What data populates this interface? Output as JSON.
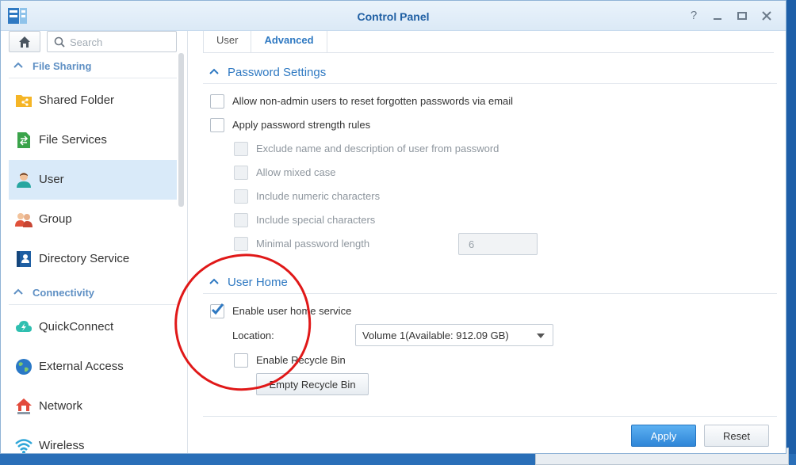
{
  "window": {
    "title": "Control Panel"
  },
  "sidebar": {
    "search_placeholder": "Search",
    "groups": [
      {
        "label": "File Sharing"
      },
      {
        "label": "Connectivity"
      }
    ],
    "items": [
      {
        "label": "Shared Folder"
      },
      {
        "label": "File Services"
      },
      {
        "label": "User"
      },
      {
        "label": "Group"
      },
      {
        "label": "Directory Service"
      },
      {
        "label": "QuickConnect"
      },
      {
        "label": "External Access"
      },
      {
        "label": "Network"
      },
      {
        "label": "Wireless"
      }
    ],
    "active_item": "User"
  },
  "tabs": [
    {
      "label": "User"
    },
    {
      "label": "Advanced"
    }
  ],
  "active_tab": "Advanced",
  "password_settings": {
    "title": "Password Settings",
    "reset_via_email": {
      "label": "Allow non-admin users to reset forgotten passwords via email",
      "checked": false
    },
    "strength_rules": {
      "label": "Apply password strength rules",
      "checked": false
    },
    "rules": [
      {
        "label": "Exclude name and description of user from password",
        "checked": false
      },
      {
        "label": "Allow mixed case",
        "checked": false
      },
      {
        "label": "Include numeric characters",
        "checked": false
      },
      {
        "label": "Include special characters",
        "checked": false
      },
      {
        "label": "Minimal password length",
        "checked": false
      }
    ],
    "min_length_value": "6"
  },
  "user_home": {
    "title": "User Home",
    "enable_home": {
      "label": "Enable user home service",
      "checked": true
    },
    "location_label": "Location:",
    "location_value": "Volume 1(Available: 912.09 GB)",
    "recycle_bin": {
      "label": "Enable Recycle Bin",
      "checked": false
    },
    "empty_recycle_label": "Empty Recycle Bin"
  },
  "footer": {
    "apply_label": "Apply",
    "reset_label": "Reset"
  },
  "colors": {
    "accent": "#2f79c2",
    "annotation": "#e01818"
  }
}
